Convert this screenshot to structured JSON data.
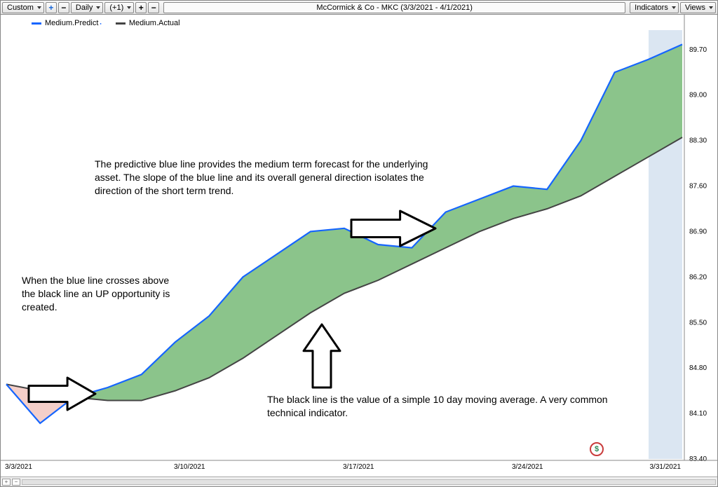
{
  "toolbar": {
    "custom_label": "Custom",
    "daily_label": "Daily",
    "offset_label": "(+1)",
    "title": "McCormick & Co - MKC (3/3/2021 - 4/1/2021)",
    "indicators_label": "Indicators",
    "views_label": "Views"
  },
  "legend": {
    "predict": "Medium.Predict",
    "actual": "Medium.Actual",
    "predict_color": "#1565ff",
    "actual_color": "#444444"
  },
  "annotations": {
    "a1": "The predictive blue line provides the medium term forecast for the underlying asset.  The slope of the blue line and its overall general direction isolates the direction of the short term trend.",
    "a2": "When the blue line crosses above the black line an UP opportunity is created.",
    "a3": "The black line is the value of a simple 10 day moving average.  A very common technical indicator."
  },
  "footer": {
    "plus": "+",
    "minus": "−"
  },
  "watermark_glyph": "$",
  "chart_data": {
    "type": "line",
    "title": "McCormick & Co - MKC (3/3/2021 - 4/1/2021)",
    "xlabel": "",
    "ylabel": "",
    "ylim": [
      83.4,
      90.0
    ],
    "y_ticks": [
      83.4,
      84.1,
      84.8,
      85.5,
      86.2,
      86.9,
      87.6,
      88.3,
      89.0,
      89.7
    ],
    "x_ticks": [
      "3/3/2021",
      "3/10/2021",
      "3/17/2021",
      "3/24/2021",
      "3/31/2021"
    ],
    "x_index_range": [
      0,
      20
    ],
    "fill_between": {
      "color_above": "#8bc48b",
      "color_below": "#f5cfc9",
      "note": "Area between Predict and Actual; green when Predict>Actual, pink when Predict<Actual"
    },
    "series": [
      {
        "name": "Medium.Predict",
        "color": "#1565ff",
        "values": [
          84.55,
          83.95,
          84.35,
          84.5,
          84.7,
          85.2,
          85.6,
          86.2,
          86.55,
          86.9,
          86.95,
          86.7,
          86.65,
          87.2,
          87.4,
          87.6,
          87.55,
          88.3,
          89.35,
          89.55,
          89.78
        ]
      },
      {
        "name": "Medium.Actual",
        "color": "#444444",
        "values": [
          84.55,
          84.45,
          84.35,
          84.3,
          84.3,
          84.45,
          84.65,
          84.95,
          85.3,
          85.65,
          85.95,
          86.15,
          86.4,
          86.65,
          86.9,
          87.1,
          87.25,
          87.45,
          87.75,
          88.05,
          88.35
        ]
      }
    ]
  }
}
